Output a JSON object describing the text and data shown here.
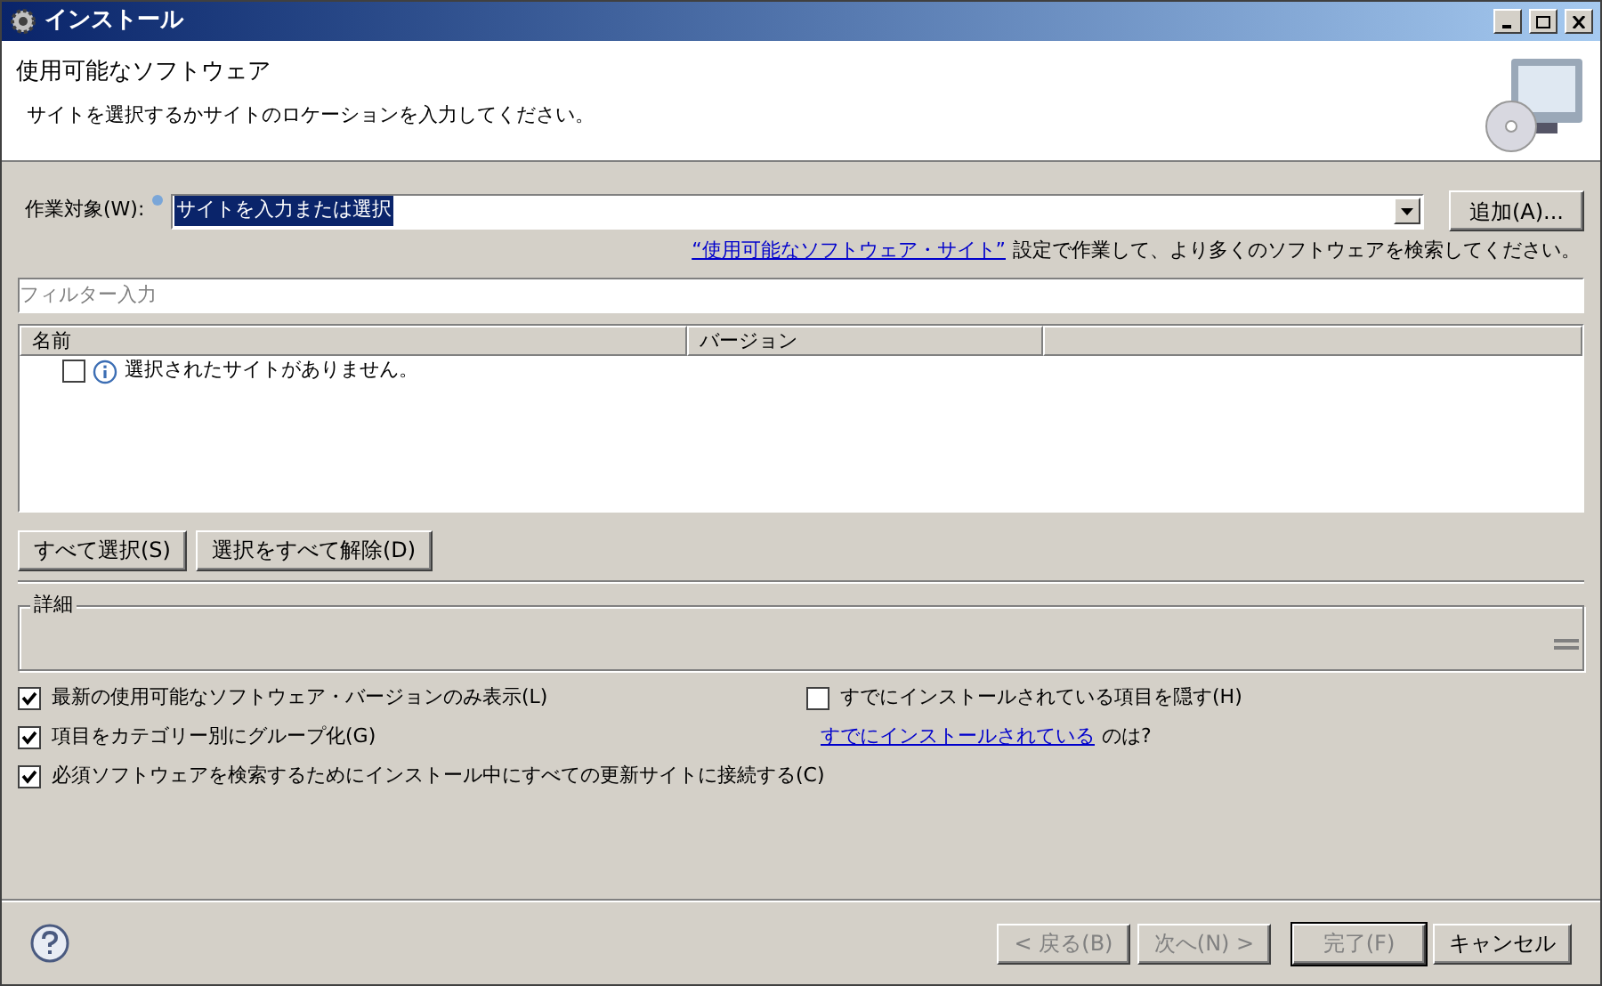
{
  "window": {
    "title": "インストール"
  },
  "header": {
    "title": "使用可能なソフトウェア",
    "description": "サイトを選択するかサイトのロケーションを入力してください。"
  },
  "work_with": {
    "label": "作業対象(W):",
    "value": "サイトを入力または選択",
    "add_button": "追加(A)..."
  },
  "sites_hint": {
    "link": "“使用可能なソフトウェア・サイト”",
    "text": "設定で作業して、より多くのソフトウェアを検索してください。"
  },
  "filter": {
    "placeholder": "フィルター入力"
  },
  "table": {
    "columns": [
      "名前",
      "バージョン"
    ],
    "rows": [
      {
        "checked": false,
        "name": "選択されたサイトがありません。"
      }
    ]
  },
  "selection_buttons": [
    "すべて選択(S)",
    "選択をすべて解除(D)"
  ],
  "details": {
    "title": "詳細"
  },
  "options_left": [
    {
      "label": "最新の使用可能なソフトウェア・バージョンのみ表示(L)",
      "checked": true
    },
    {
      "label": "項目をカテゴリー別にグループ化(G)",
      "checked": true
    },
    {
      "label": "必須ソフトウェアを検索するためにインストール中にすべての更新サイトに接続する(C)",
      "checked": true
    }
  ],
  "options_right": [
    {
      "label": "すでにインストールされている項目を隠す(H)",
      "checked": false
    }
  ],
  "installed_hint": {
    "link": "すでにインストールされている",
    "text": "のは?"
  },
  "footer_buttons": [
    {
      "label": "< 戻る(B)",
      "disabled": true
    },
    {
      "label": "次へ(N) >",
      "disabled": true
    },
    {
      "label": "完了(F)",
      "disabled": true
    },
    {
      "label": "キャンセル",
      "disabled": false
    }
  ]
}
